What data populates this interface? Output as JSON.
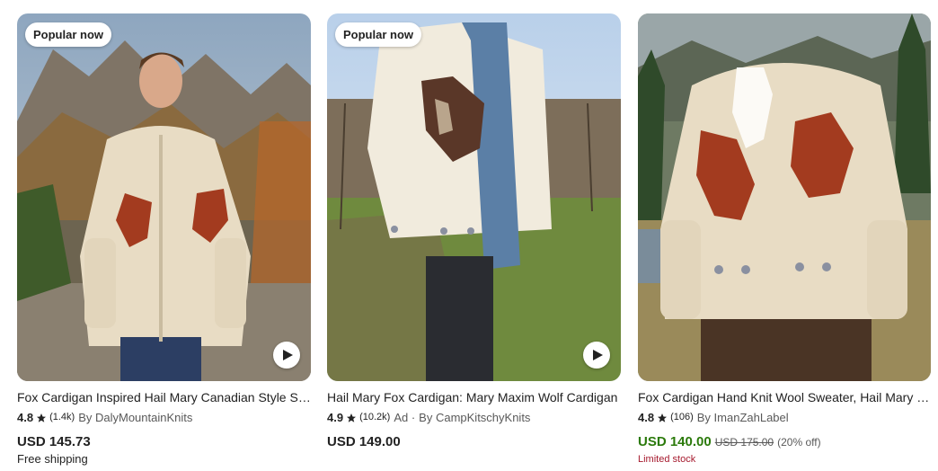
{
  "listings": [
    {
      "badge": "Popular now",
      "title": "Fox Cardigan Inspired Hail Mary Canadian Style Sweater",
      "rating": "4.8",
      "review_count": "(1.4k)",
      "ad_label": "",
      "shop": "By DalyMountainKnits",
      "price": "USD 145.73",
      "original_price": "",
      "discount": "",
      "extra": "Free shipping",
      "has_video": true
    },
    {
      "badge": "Popular now",
      "title": "Hail Mary Fox Cardigan: Mary Maxim Wolf Cardigan",
      "rating": "4.9",
      "review_count": "(10.2k)",
      "ad_label": "Ad · ",
      "shop": "By CampKitschyKnits",
      "price": "USD 149.00",
      "original_price": "",
      "discount": "",
      "extra": "",
      "has_video": true
    },
    {
      "badge": "",
      "title": "Fox Cardigan Hand Knit Wool Sweater, Hail Mary Cardigan",
      "rating": "4.8",
      "review_count": "(106)",
      "ad_label": "",
      "shop": "By ImanZahLabel",
      "price": "USD 140.00",
      "original_price": "USD 175.00",
      "discount": "(20% off)",
      "extra": "Limited stock",
      "has_video": false
    }
  ],
  "colors": {
    "sale_price": "#2b7a0b",
    "limited_stock": "#a61a2e",
    "sweater": "#e8dcc4",
    "fox": "#a33b1f"
  }
}
